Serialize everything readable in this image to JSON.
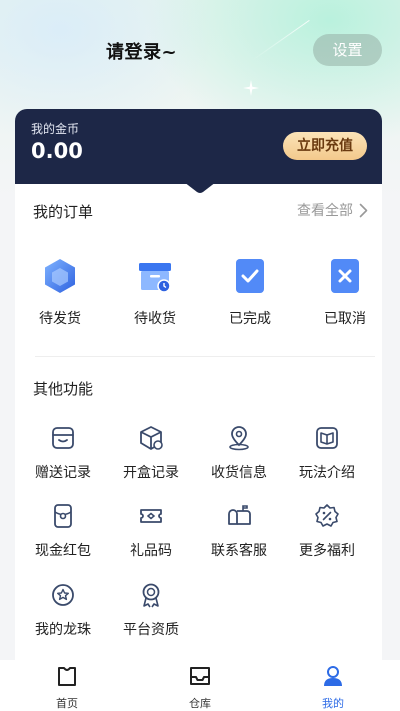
{
  "header": {
    "login_prompt": "请登录~",
    "settings_label": "设置"
  },
  "wallet": {
    "label": "我的金币",
    "balance": "0.00",
    "recharge_label": "立即充值"
  },
  "orders": {
    "title": "我的订单",
    "view_all": "查看全部",
    "items": [
      {
        "label": "待发货",
        "icon": "cube-icon"
      },
      {
        "label": "待收货",
        "icon": "delivery-box-icon"
      },
      {
        "label": "已完成",
        "icon": "check-document-icon"
      },
      {
        "label": "已取消",
        "icon": "cancel-document-icon"
      }
    ]
  },
  "functions": {
    "title": "其他功能",
    "items": [
      {
        "label": "赠送记录",
        "icon": "gift-record-icon"
      },
      {
        "label": "开盒记录",
        "icon": "box-open-icon"
      },
      {
        "label": "收货信息",
        "icon": "location-icon"
      },
      {
        "label": "玩法介绍",
        "icon": "book-icon"
      },
      {
        "label": "现金红包",
        "icon": "red-packet-icon"
      },
      {
        "label": "礼品码",
        "icon": "ticket-icon"
      },
      {
        "label": "联系客服",
        "icon": "mailbox-icon"
      },
      {
        "label": "更多福利",
        "icon": "discount-icon"
      },
      {
        "label": "我的龙珠",
        "icon": "star-coin-icon"
      },
      {
        "label": "平台资质",
        "icon": "badge-icon"
      }
    ]
  },
  "tabbar": {
    "items": [
      {
        "label": "首页",
        "icon": "bag-icon",
        "active": false
      },
      {
        "label": "仓库",
        "icon": "inbox-icon",
        "active": false
      },
      {
        "label": "我的",
        "icon": "user-icon",
        "active": true
      }
    ]
  },
  "colors": {
    "accent": "#2d6be6",
    "card": "#1d2747",
    "recharge": "#f3c98c",
    "icon_stroke": "#3a4a6b"
  }
}
